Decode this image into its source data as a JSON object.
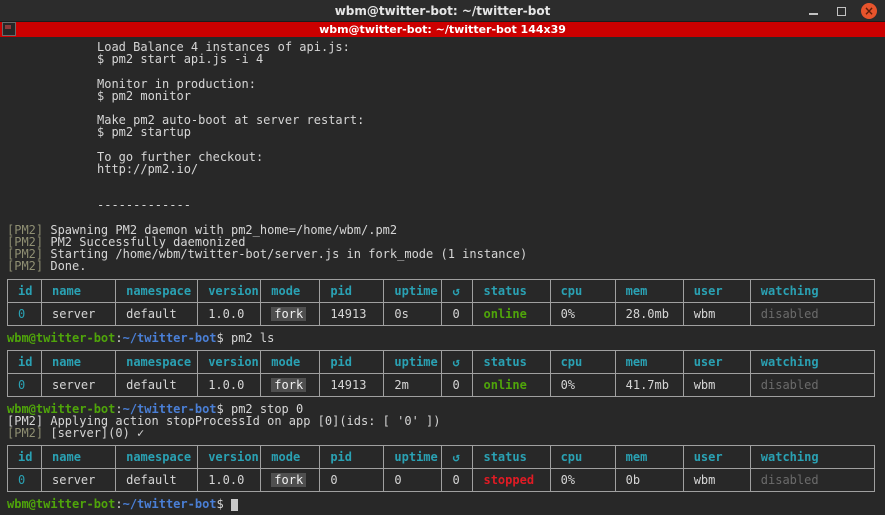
{
  "window": {
    "title": "wbm@twitter-bot: ~/twitter-bot",
    "controls": {
      "close": "×"
    }
  },
  "xterm_bar": {
    "title": "wbm@twitter-bot: ~/twitter-bot 144x39"
  },
  "colors": {
    "titlebar_bg": "#2c2c2c",
    "xterm_bar_bg": "#cc0000",
    "terminal_bg": "#282828",
    "text": "#d6d6d6",
    "green": "#4fa50a",
    "blue": "#4a7fd6",
    "cyan": "#2aa1b3",
    "red": "#e01b24",
    "dim": "#6b6b6b",
    "log_tag": "#8f8f73",
    "close_button": "#e8542c",
    "table_border": "#a0a0a0",
    "fork_badge_bg": "#4f4f4f",
    "cursor": "#c9c9c9"
  },
  "icons": {
    "minimize": "minimize-icon",
    "maximize": "maximize-icon",
    "close": "close-icon",
    "terminal_app": "terminal-app-icon",
    "restart_symbol": "↺",
    "check_symbol": "✓"
  },
  "intro": {
    "lines": [
      "Load Balance 4 instances of api.js:",
      "$ pm2 start api.js -i 4",
      "",
      "Monitor in production:",
      "$ pm2 monitor",
      "",
      "Make pm2 auto-boot at server restart:",
      "$ pm2 startup",
      "",
      "To go further checkout:",
      "http://pm2.io/",
      "",
      "",
      "-------------",
      ""
    ]
  },
  "boot_log": [
    {
      "prefix": "[PM2]",
      "text": " Spawning PM2 daemon with pm2_home=/home/wbm/.pm2"
    },
    {
      "prefix": "[PM2]",
      "text": " PM2 Successfully daemonized"
    },
    {
      "prefix": "[PM2]",
      "text": " Starting /home/wbm/twitter-bot/server.js in fork_mode (1 instance)"
    },
    {
      "prefix": "[PM2]",
      "text": " Done."
    }
  ],
  "prompt": {
    "user_host": "wbm@twitter-bot",
    "colon": ":",
    "path": "~/twitter-bot",
    "dollar": "$ "
  },
  "commands": {
    "ls": "pm2 ls",
    "stop": "pm2 stop 0",
    "empty": ""
  },
  "stop_log": [
    {
      "prefix": "[PM2]",
      "text": " Applying action stopProcessId on app [0](ids: [ '0' ])"
    },
    {
      "prefix": "[PM2]",
      "text": " [server](0) ",
      "check": "✓"
    }
  ],
  "table": {
    "headers": [
      "id",
      "name",
      "namespace",
      "version",
      "mode",
      "pid",
      "uptime",
      "↺",
      "status",
      "cpu",
      "mem",
      "user",
      "watching"
    ],
    "field_keys": [
      "id",
      "name",
      "namespace",
      "version",
      "mode",
      "pid",
      "uptime",
      "restarts",
      "status",
      "cpu",
      "mem",
      "user",
      "watching"
    ]
  },
  "process_tables": [
    {
      "cells": [
        "0",
        "server",
        "default",
        "1.0.0",
        "fork",
        "14913",
        "0s",
        "0",
        "online",
        "0%",
        "28.0mb",
        "wbm",
        "disabled"
      ]
    },
    {
      "cells": [
        "0",
        "server",
        "default",
        "1.0.0",
        "fork",
        "14913",
        "2m",
        "0",
        "online",
        "0%",
        "41.7mb",
        "wbm",
        "disabled"
      ]
    },
    {
      "cells": [
        "0",
        "server",
        "default",
        "1.0.0",
        "fork",
        "0",
        "0",
        "0",
        "stopped",
        "0%",
        "0b",
        "wbm",
        "disabled"
      ]
    }
  ]
}
